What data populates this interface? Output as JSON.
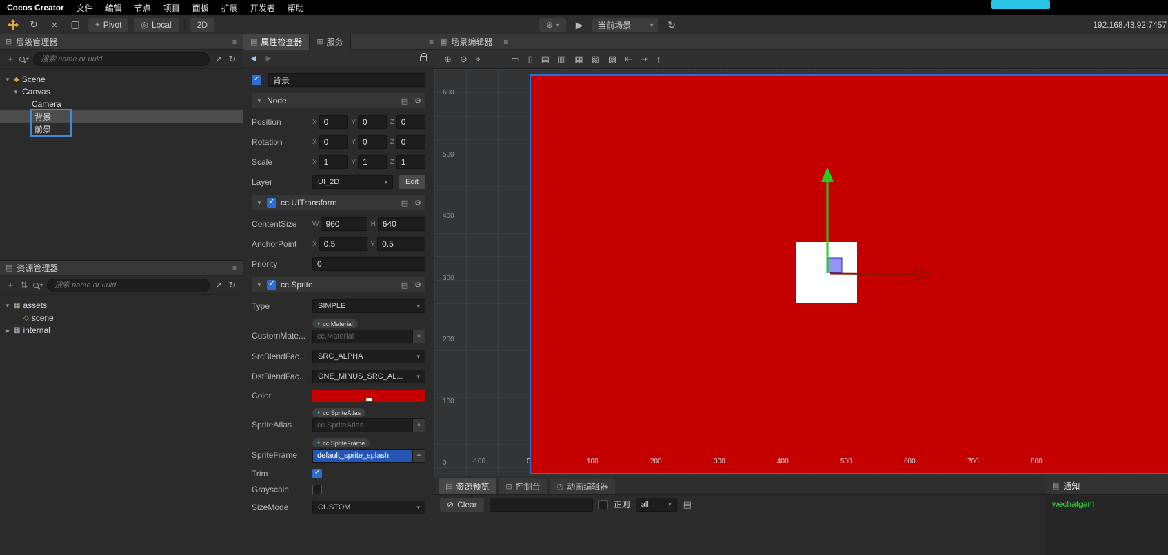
{
  "icons": {
    "menu": "≡",
    "plus": "+",
    "caret_down": "▼",
    "caret_right": "▶",
    "nav_left": "◀",
    "nav_right": "▶",
    "refresh": "↻",
    "expand": "↗",
    "gear": "⚙",
    "doc": "▤",
    "grid": "⊞",
    "tree": "⊟",
    "scene_diamond": "◆",
    "asset_scene": "◇",
    "folder": "▤",
    "bundle": "▦",
    "play": "▶",
    "globe": "⊕",
    "dd": "▾",
    "close": "×",
    "frame": "▢",
    "pivot": "⌖",
    "local": "◎",
    "sort": "⇅",
    "pick": "⌖",
    "clear": "⊘",
    "page": "▤",
    "anim": "◷",
    "console": "⊡",
    "zoom_in": "⊕",
    "zoom_out": "⊖",
    "zoom_fit": "⌖",
    "align1": "▭",
    "align2": "▯",
    "align3": "▤",
    "align4": "▥",
    "align5": "▦",
    "align6": "▧",
    "align7": "▨",
    "align8": "⇤",
    "align9": "⇥",
    "align10": "↕"
  },
  "menu": {
    "app": "Cocos Creator",
    "items": [
      "文件",
      "编辑",
      "节点",
      "项目",
      "面板",
      "扩展",
      "开发者",
      "帮助"
    ]
  },
  "toolbar": {
    "pivot": "Pivot",
    "local": "Local",
    "mode2d": "2D",
    "scene_select": "当前场景",
    "address": "192.168.43.92:7457"
  },
  "hierarchy": {
    "title": "层级管理器",
    "search_placeholder": "搜索 name or uuid",
    "items": [
      {
        "label": "Scene"
      },
      {
        "label": "Canvas"
      },
      {
        "label": "Camera"
      },
      {
        "label": "背景"
      },
      {
        "label": "前景"
      }
    ]
  },
  "assets": {
    "title": "资源管理器",
    "search_placeholder": "搜索 name or uuid",
    "items": [
      {
        "label": "assets"
      },
      {
        "label": "scene"
      },
      {
        "label": "internal"
      }
    ]
  },
  "inspector": {
    "tab_properties": "属性检查器",
    "tab_services": "服务",
    "node_name": "背景",
    "axis": {
      "x": "X",
      "y": "Y",
      "z": "Z",
      "w": "W",
      "h": "H"
    },
    "node": {
      "title": "Node",
      "position_label": "Position",
      "px": "0",
      "py": "0",
      "pz": "0",
      "rotation_label": "Rotation",
      "rx": "0",
      "ry": "0",
      "rz": "0",
      "scale_label": "Scale",
      "sx": "1",
      "sy": "1",
      "sz": "1",
      "layer_label": "Layer",
      "layer_value": "UI_2D",
      "edit_label": "Edit"
    },
    "uitransform": {
      "title": "cc.UITransform",
      "contentsize_label": "ContentSize",
      "w": "960",
      "h": "640",
      "anchorpoint_label": "AnchorPoint",
      "ax": "0.5",
      "ay": "0.5",
      "priority_label": "Priority",
      "priority": "0"
    },
    "sprite": {
      "title": "cc.Sprite",
      "type_label": "Type",
      "type_value": "SIMPLE",
      "custom_material_label": "CustomMate...",
      "material_chip": "cc.Material",
      "material_placeholder": "cc.Material",
      "src_blend_label": "SrcBlendFac...",
      "src_blend_value": "SRC_ALPHA",
      "dst_blend_label": "DstBlendFac...",
      "dst_blend_value": "ONE_MINUS_SRC_AL...",
      "color_label": "Color",
      "color_value": "#C40000",
      "sprite_atlas_label": "SpriteAtlas",
      "atlas_chip": "cc.SpriteAtlas",
      "atlas_placeholder": "cc.SpriteAtlas",
      "sprite_frame_label": "SpriteFrame",
      "frame_chip": "cc.SpriteFrame",
      "frame_value": "default_sprite_splash",
      "trim_label": "Trim",
      "grayscale_label": "Grayscale",
      "size_mode_label": "SizeMode",
      "size_mode_value": "CUSTOM"
    }
  },
  "scene": {
    "title": "场景编辑器",
    "canvas_color": "#C40000",
    "ruler_y": [
      "600",
      "500",
      "400",
      "300",
      "200",
      "100",
      "0"
    ],
    "ruler_x": [
      "-100",
      "0",
      "100",
      "200",
      "300",
      "400",
      "500",
      "600",
      "700",
      "800"
    ]
  },
  "bottom": {
    "tab_preview": "资源预览",
    "tab_console": "控制台",
    "tab_animation": "动画编辑器",
    "clear_label": "Clear",
    "regex_label": "正则",
    "filter_value": "all"
  },
  "notification": {
    "title": "通知",
    "message": "wechatgam"
  }
}
